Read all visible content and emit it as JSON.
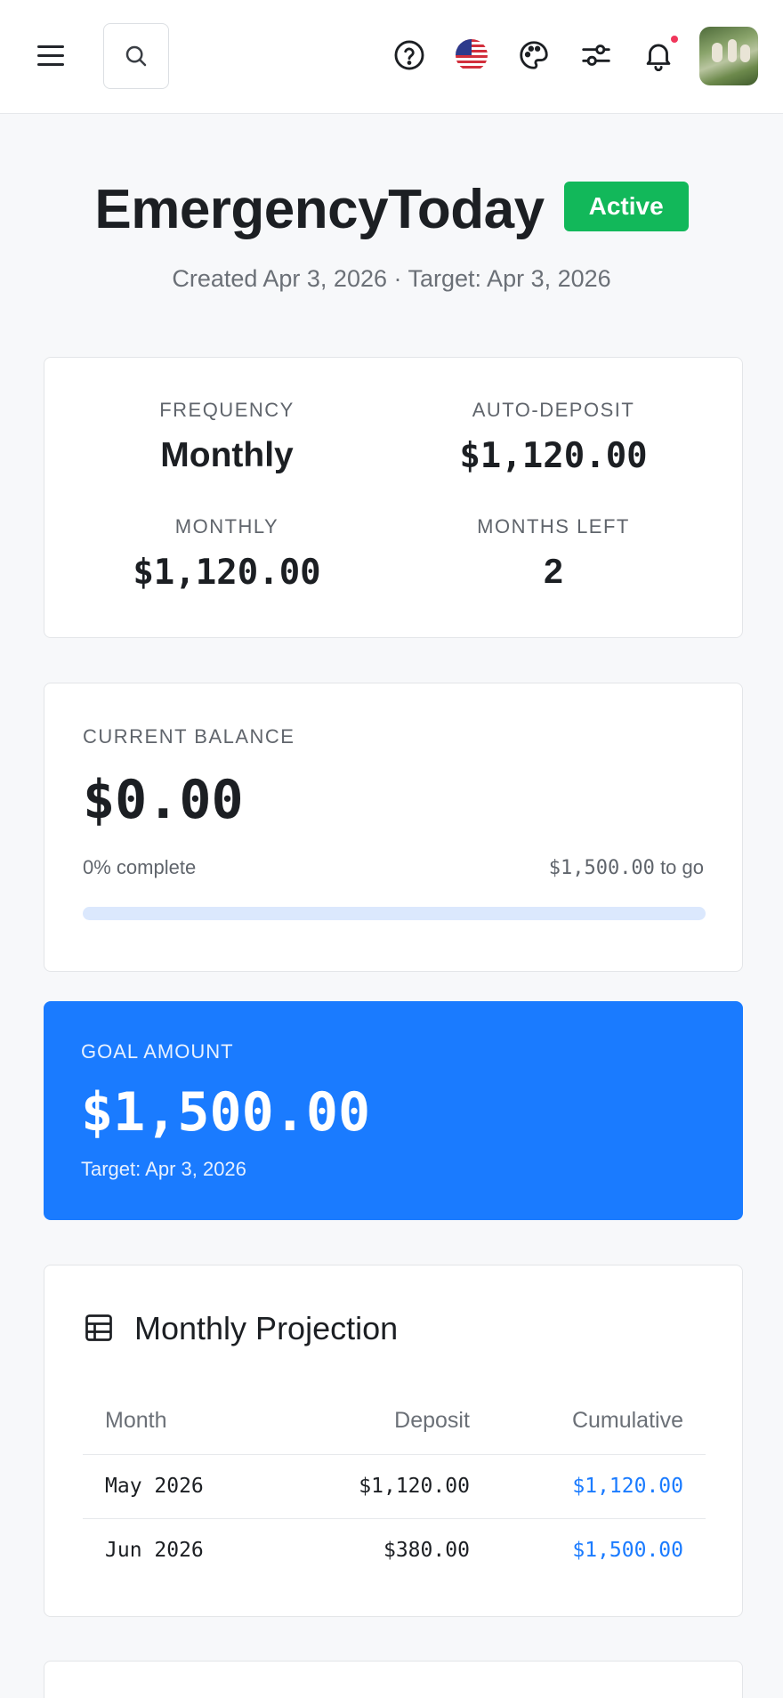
{
  "header": {
    "icons": {
      "menu": "hamburger-menu-icon",
      "search": "search-icon",
      "help": "help-circle-icon",
      "language": "us-flag-icon",
      "theme": "palette-icon",
      "settings": "sliders-icon",
      "notifications": "bell-icon"
    },
    "notification_dot_color": "#f0365b"
  },
  "goal": {
    "title": "EmergencyToday",
    "status": "Active",
    "subtitle": "Created Apr 3, 2026 · Target: Apr 3, 2026"
  },
  "stats": {
    "frequency_label": "FREQUENCY",
    "frequency_value": "Monthly",
    "autodeposit_label": "AUTO-DEPOSIT",
    "autodeposit_value": "$1,120.00",
    "monthly_label": "MONTHLY",
    "monthly_value": "$1,120.00",
    "months_left_label": "MONTHS LEFT",
    "months_left_value": "2"
  },
  "balance": {
    "label": "CURRENT BALANCE",
    "value": "$0.00",
    "percent_text": "0% complete",
    "to_go_amount": "$1,500.00",
    "to_go_suffix": "to go",
    "progress_fraction": 0
  },
  "goal_amount": {
    "label": "GOAL AMOUNT",
    "value": "$1,500.00",
    "target": "Target: Apr 3, 2026"
  },
  "projection": {
    "title": "Monthly Projection",
    "icon": "table-grid-icon",
    "columns": [
      "Month",
      "Deposit",
      "Cumulative"
    ],
    "rows": [
      {
        "month": "May 2026",
        "deposit": "$1,120.00",
        "cumulative": "$1,120.00"
      },
      {
        "month": "Jun 2026",
        "deposit": "$380.00",
        "cumulative": "$1,500.00"
      }
    ]
  },
  "colors": {
    "accent": "#1a7bff",
    "success": "#12b85a",
    "text": "#1c1f23",
    "muted": "#6b7077"
  }
}
